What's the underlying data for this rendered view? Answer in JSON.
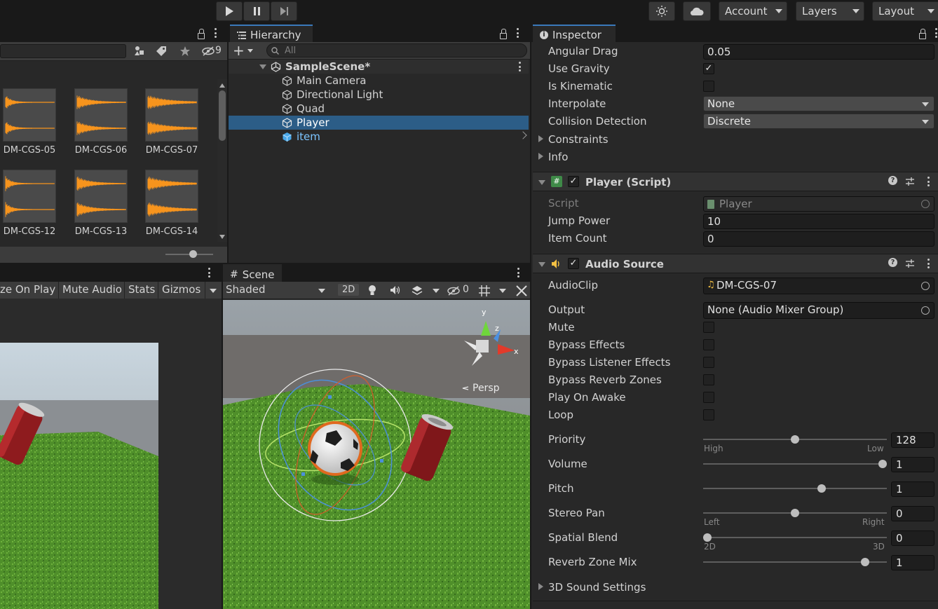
{
  "toolbar": {
    "account": "Account",
    "layers": "Layers",
    "layout": "Layout"
  },
  "project": {
    "hidden_count": "9",
    "clips": [
      {
        "name": "DM-CGS-05"
      },
      {
        "name": "DM-CGS-06"
      },
      {
        "name": "DM-CGS-07"
      },
      {
        "name": "DM-CGS-12"
      },
      {
        "name": "DM-CGS-13"
      },
      {
        "name": "DM-CGS-14"
      }
    ]
  },
  "hierarchy": {
    "tab": "Hierarchy",
    "search_placeholder": "All",
    "scene": "SampleScene*",
    "items": [
      {
        "label": "Main Camera"
      },
      {
        "label": "Directional Light"
      },
      {
        "label": "Quad"
      },
      {
        "label": "Player"
      },
      {
        "label": "item"
      }
    ]
  },
  "game": {
    "maximize_on_play": "ze On Play",
    "mute_audio": "Mute Audio",
    "stats": "Stats",
    "gizmos": "Gizmos"
  },
  "scene_view": {
    "tab": "Scene",
    "shading": "Shaded",
    "mode_2d": "2D",
    "hidden_count": "0",
    "persp": "Persp",
    "axis_x": "x",
    "axis_y": "y",
    "axis_z": "z"
  },
  "inspector": {
    "tab": "Inspector",
    "rigidbody": {
      "angular_drag_label": "Angular Drag",
      "angular_drag": "0.05",
      "use_gravity_label": "Use Gravity",
      "use_gravity": true,
      "is_kinematic_label": "Is Kinematic",
      "is_kinematic": false,
      "interpolate_label": "Interpolate",
      "interpolate": "None",
      "collision_label": "Collision Detection",
      "collision": "Discrete",
      "constraints_label": "Constraints",
      "info_label": "Info"
    },
    "player_script": {
      "title": "Player (Script)",
      "script_label": "Script",
      "script": "Player",
      "jump_power_label": "Jump Power",
      "jump_power": "10",
      "item_count_label": "Item Count",
      "item_count": "0"
    },
    "audio_source": {
      "title": "Audio Source",
      "audioclip_label": "AudioClip",
      "audioclip": "DM-CGS-07",
      "output_label": "Output",
      "output": "None (Audio Mixer Group)",
      "mute_label": "Mute",
      "bypass_effects_label": "Bypass Effects",
      "bypass_listener_label": "Bypass Listener Effects",
      "bypass_reverb_label": "Bypass Reverb Zones",
      "play_on_awake_label": "Play On Awake",
      "loop_label": "Loop",
      "priority_label": "Priority",
      "priority": "128",
      "priority_fraction": 0.5,
      "priority_high": "High",
      "priority_low": "Low",
      "volume_label": "Volume",
      "volume": "1",
      "volume_fraction": 1.0,
      "pitch_label": "Pitch",
      "pitch": "1",
      "pitch_fraction": 0.65,
      "stereo_pan_label": "Stereo Pan",
      "stereo_pan": "0",
      "stereo_pan_fraction": 0.5,
      "stereo_left": "Left",
      "stereo_right": "Right",
      "spatial_blend_label": "Spatial Blend",
      "spatial_blend": "0",
      "spatial_blend_fraction": 0.0,
      "spatial_2d": "2D",
      "spatial_3d": "3D",
      "reverb_mix_label": "Reverb Zone Mix",
      "reverb_mix": "1",
      "reverb_mix_fraction": 0.9,
      "sound_settings_label": "3D Sound Settings"
    }
  },
  "colors": {
    "selection": "#2c5d87",
    "accent_tab": "#3a79bb",
    "waveform": "#f7941d",
    "item_prefab": "#7cc4ff"
  }
}
